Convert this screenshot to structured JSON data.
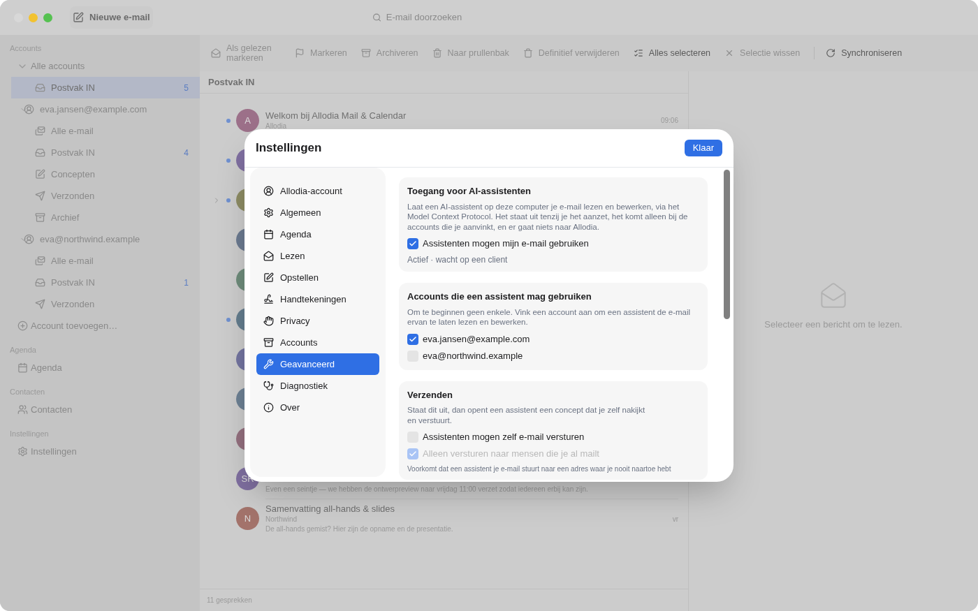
{
  "window": {
    "compose_button": "Nieuwe e-mail",
    "search": {
      "placeholder": "E-mail doorzoeken"
    }
  },
  "sidebar": {
    "sections": [
      {
        "title": "Accounts",
        "items": [
          {
            "label": "Alle accounts",
            "kind": "group",
            "selected": false,
            "expanded": true,
            "children": [
              {
                "label": "Postvak IN",
                "kind": "inbox",
                "count": "5",
                "selected": true
              }
            ]
          },
          {
            "label": "eva.jansen@example.com",
            "kind": "account",
            "selected": false,
            "expanded": true,
            "children": [
              {
                "label": "Alle e-mail",
                "kind": "all-mail",
                "selected": false
              },
              {
                "label": "Postvak IN",
                "kind": "inbox",
                "count": "4",
                "selected": false
              },
              {
                "label": "Concepten",
                "kind": "drafts",
                "selected": false
              },
              {
                "label": "Verzonden",
                "kind": "sent",
                "selected": false
              },
              {
                "label": "Archief",
                "kind": "archive",
                "selected": false
              }
            ]
          },
          {
            "label": "eva@northwind.example",
            "kind": "account",
            "selected": false,
            "expanded": true,
            "children": [
              {
                "label": "Alle e-mail",
                "kind": "all-mail",
                "selected": false
              },
              {
                "label": "Postvak IN",
                "kind": "inbox",
                "count": "1",
                "selected": false
              },
              {
                "label": "Verzonden",
                "kind": "sent",
                "selected": false
              }
            ]
          },
          {
            "label": "Account toevoegen…",
            "kind": "add",
            "selected": false
          }
        ]
      },
      {
        "title": "Agenda",
        "items": [
          {
            "label": "Agenda",
            "kind": "calendar",
            "selected": false
          }
        ]
      },
      {
        "title": "Contacten",
        "items": [
          {
            "label": "Contacten",
            "kind": "contacts",
            "selected": false
          }
        ]
      },
      {
        "title": "Instellingen",
        "items": [
          {
            "label": "Instellingen",
            "kind": "settings",
            "selected": false
          }
        ]
      }
    ]
  },
  "toolbar": [
    {
      "label": "Als gelezen markeren",
      "kind": "mark-read",
      "disabled": true
    },
    {
      "label": "Markeren",
      "kind": "flag",
      "disabled": true
    },
    {
      "label": "Archiveren",
      "kind": "archive",
      "disabled": true
    },
    {
      "label": "Naar prullenbak",
      "kind": "trash",
      "disabled": true
    },
    {
      "label": "Definitief verwijderen",
      "kind": "delete",
      "disabled": true
    },
    {
      "label": "Alles selecteren",
      "kind": "select-all",
      "disabled": false
    },
    {
      "label": "Selectie wissen",
      "kind": "clear",
      "disabled": true
    },
    {
      "label": "Synchroniseren",
      "kind": "sync",
      "disabled": false
    }
  ],
  "message_list": {
    "title": "Postvak IN",
    "footer": "11 gesprekken",
    "messages": [
      {
        "avatar": "A",
        "color": "#9c7089",
        "unread": true,
        "thread": false,
        "subject": "Welkom bij Allodia Mail & Calendar",
        "sender": "Allodia",
        "time": "09:06"
      },
      {
        "color": "#7f6fa0",
        "unread": true,
        "thread": false
      },
      {
        "color": "#8d8c64",
        "unread": true,
        "thread": true
      },
      {
        "color": "#6b7a90",
        "unread": false,
        "thread": false
      },
      {
        "color": "#6e8c7b",
        "unread": false,
        "thread": false
      },
      {
        "color": "#647d8e",
        "unread": true,
        "thread": false
      },
      {
        "color": "#7374a0",
        "unread": false,
        "thread": false
      },
      {
        "color": "#6d8194",
        "unread": false,
        "thread": false
      },
      {
        "color": "#94707f",
        "unread": false,
        "thread": false
      },
      {
        "avatar": "SR",
        "color": "#7f6fa0",
        "unread": false,
        "thread": false,
        "preview": "Even een seintje — we hebben de ontwerpreview naar vrijdag 11:00 verzet zodat iedereen erbij kan zijn."
      },
      {
        "avatar": "N",
        "color": "#a3736b",
        "unread": false,
        "thread": false,
        "subject": "Samenvatting all-hands & slides",
        "sender": "Northwind",
        "time": "vr",
        "preview": "De all-hands gemist? Hier zijn de opname en de presentatie."
      }
    ]
  },
  "reading_pane": {
    "empty_text": "Selecteer een bericht om te lezen."
  },
  "settings_dialog": {
    "title": "Instellingen",
    "done_button": "Klaar",
    "nav": [
      {
        "label": "Allodia-account",
        "kind": "account",
        "selected": false
      },
      {
        "label": "Algemeen",
        "kind": "general",
        "selected": false
      },
      {
        "label": "Agenda",
        "kind": "calendar",
        "selected": false
      },
      {
        "label": "Lezen",
        "kind": "reading",
        "selected": false
      },
      {
        "label": "Opstellen",
        "kind": "compose",
        "selected": false
      },
      {
        "label": "Handtekeningen",
        "kind": "signatures",
        "selected": false
      },
      {
        "label": "Privacy",
        "kind": "privacy",
        "selected": false
      },
      {
        "label": "Accounts",
        "kind": "accounts",
        "selected": false
      },
      {
        "label": "Geavanceerd",
        "kind": "advanced",
        "selected": true
      },
      {
        "label": "Diagnostiek",
        "kind": "diagnostics",
        "selected": false
      },
      {
        "label": "Over",
        "kind": "about",
        "selected": false
      }
    ],
    "sections": [
      {
        "title": "Toegang voor AI-assistenten",
        "description": "Laat een AI-assistent op deze computer je e-mail lezen en bewerken, via het Model Context Protocol. Het staat uit tenzij je het aanzet, het komt alleen bij de accounts die je aanvinkt, en er gaat niets naar Allodia.",
        "options": [
          {
            "label": "Assistenten mogen mijn e-mail gebruiken",
            "checked": true,
            "disabled": false
          }
        ],
        "note": "Actief · wacht op een client"
      },
      {
        "title": "Accounts die een assistent mag gebruiken",
        "description": "Om te beginnen geen enkele. Vink een account aan om een assistent de e-mail ervan te laten lezen en bewerken.",
        "options": [
          {
            "label": "eva.jansen@example.com",
            "checked": true,
            "disabled": false
          },
          {
            "label": "eva@northwind.example",
            "checked": false,
            "disabled": false
          }
        ]
      },
      {
        "title": "Verzenden",
        "description": "Staat dit uit, dan opent een assistent een concept dat je zelf nakijkt\nen verstuurt.",
        "options": [
          {
            "label": "Assistenten mogen zelf e-mail versturen",
            "checked": false,
            "disabled": false
          },
          {
            "label": "Alleen versturen naar mensen die je al mailt",
            "checked": true,
            "disabled": true
          }
        ],
        "note": "Voorkomt dat een assistent je e-mail stuurt naar een adres waar je nooit naartoe hebt"
      }
    ]
  }
}
